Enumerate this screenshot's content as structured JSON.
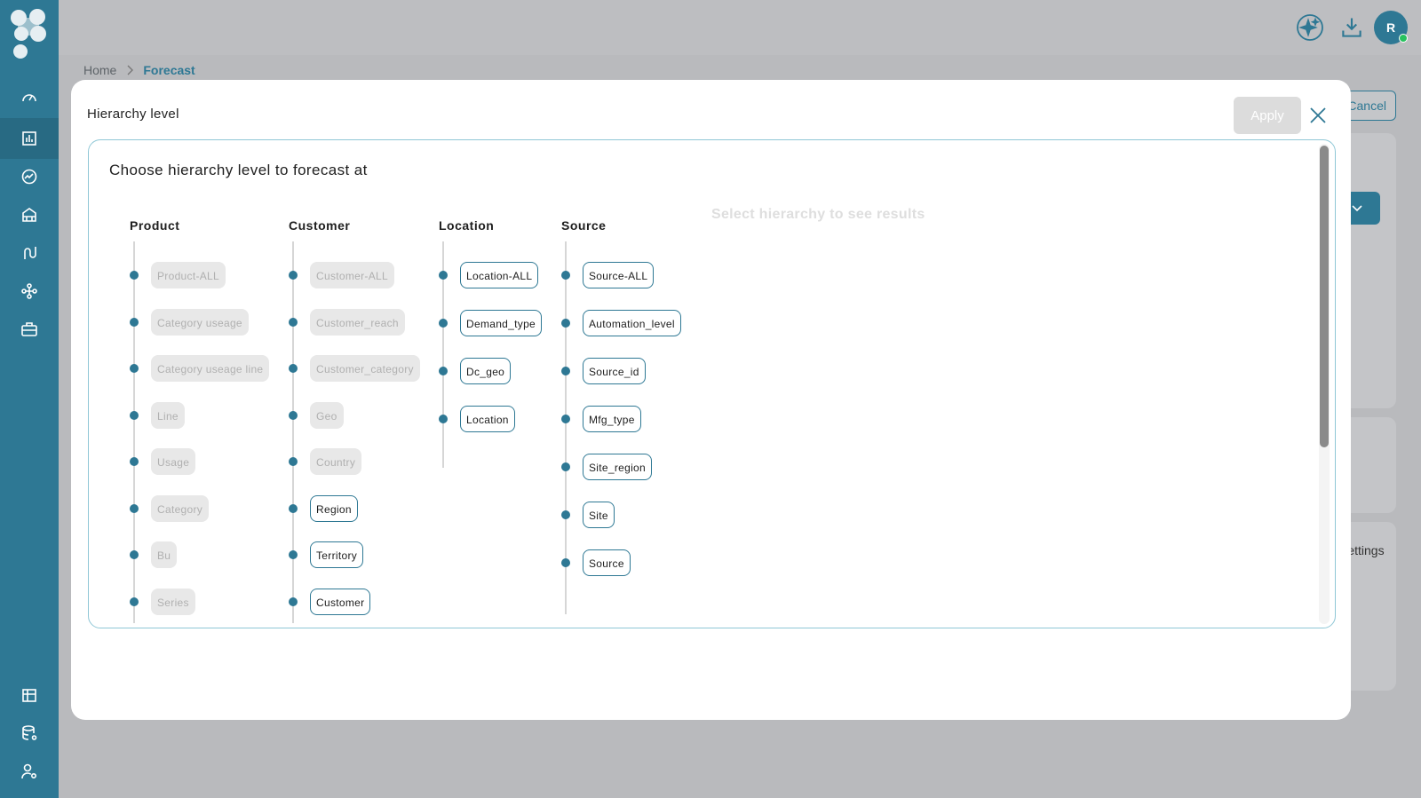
{
  "topbar": {
    "avatar_initial": "R",
    "icons": [
      "sparkle-ai-icon",
      "download-icon"
    ]
  },
  "breadcrumb": {
    "home": "Home",
    "current": "Forecast"
  },
  "background": {
    "cancel_label": "Cancel",
    "settings_label": "Settings"
  },
  "modal": {
    "title": "Hierarchy level",
    "apply_label": "Apply",
    "heading": "Choose hierarchy level to forecast at",
    "placeholder": "Select hierarchy to see results"
  },
  "columns": [
    {
      "title": "Product",
      "items": [
        {
          "label": "Product-ALL",
          "enabled": false
        },
        {
          "label": "Category useage",
          "enabled": false
        },
        {
          "label": "Category useage line",
          "enabled": false
        },
        {
          "label": "Line",
          "enabled": false
        },
        {
          "label": "Usage",
          "enabled": false
        },
        {
          "label": "Category",
          "enabled": false
        },
        {
          "label": "Bu",
          "enabled": false
        },
        {
          "label": "Series",
          "enabled": false
        }
      ]
    },
    {
      "title": "Customer",
      "items": [
        {
          "label": "Customer-ALL",
          "enabled": false
        },
        {
          "label": "Customer_reach",
          "enabled": false
        },
        {
          "label": "Customer_category",
          "enabled": false
        },
        {
          "label": "Geo",
          "enabled": false
        },
        {
          "label": "Country",
          "enabled": false
        },
        {
          "label": "Region",
          "enabled": true
        },
        {
          "label": "Territory",
          "enabled": true
        },
        {
          "label": "Customer",
          "enabled": true
        }
      ]
    },
    {
      "title": "Location",
      "items": [
        {
          "label": "Location-ALL",
          "enabled": true
        },
        {
          "label": "Demand_type",
          "enabled": true
        },
        {
          "label": "Dc_geo",
          "enabled": true
        },
        {
          "label": "Location",
          "enabled": true
        }
      ]
    },
    {
      "title": "Source",
      "items": [
        {
          "label": "Source-ALL",
          "enabled": true
        },
        {
          "label": "Automation_level",
          "enabled": true
        },
        {
          "label": "Source_id",
          "enabled": true
        },
        {
          "label": "Mfg_type",
          "enabled": true
        },
        {
          "label": "Site_region",
          "enabled": true
        },
        {
          "label": "Site",
          "enabled": true
        },
        {
          "label": "Source",
          "enabled": true
        }
      ]
    }
  ],
  "sidebar": {
    "top_icons": [
      "dashboard-gauge-icon",
      "forecast-chart-icon",
      "analytics-icon",
      "inventory-icon",
      "route-icon",
      "network-icon",
      "briefcase-icon"
    ],
    "bottom_icons": [
      "reports-icon",
      "database-settings-icon",
      "user-settings-icon"
    ]
  }
}
